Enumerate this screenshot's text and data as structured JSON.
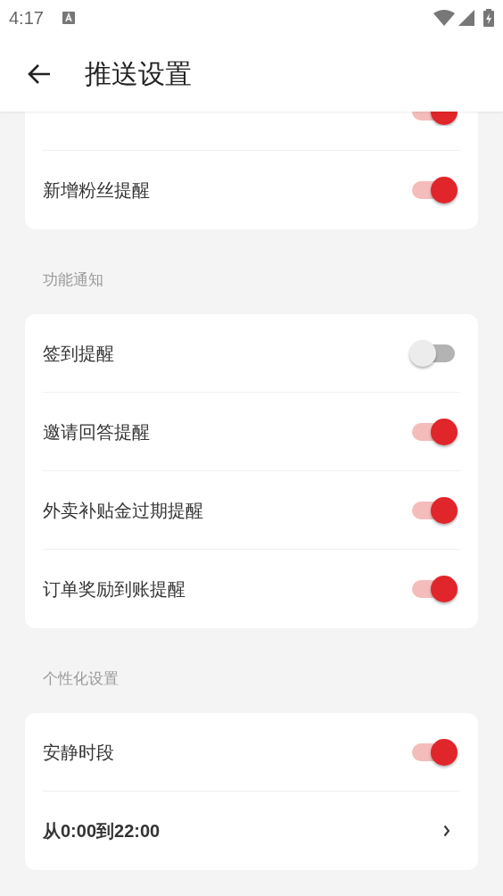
{
  "status_bar": {
    "time": "4:17"
  },
  "app_bar": {
    "title": "推送设置"
  },
  "sections": [
    {
      "items": [
        {
          "kind": "toggle",
          "partly_hidden": true,
          "on": true
        },
        {
          "kind": "toggle",
          "label": "新增粉丝提醒",
          "on": true
        }
      ]
    },
    {
      "header": "功能通知",
      "items": [
        {
          "kind": "toggle",
          "label": "签到提醒",
          "on": false
        },
        {
          "kind": "toggle",
          "label": "邀请回答提醒",
          "on": true
        },
        {
          "kind": "toggle",
          "label": "外卖补贴金过期提醒",
          "on": true
        },
        {
          "kind": "toggle",
          "label": "订单奖励到账提醒",
          "on": true
        }
      ]
    },
    {
      "header": "个性化设置",
      "items": [
        {
          "kind": "toggle",
          "label": "安静时段",
          "on": true
        },
        {
          "kind": "link",
          "label": "从0:00到22:00"
        }
      ]
    }
  ]
}
